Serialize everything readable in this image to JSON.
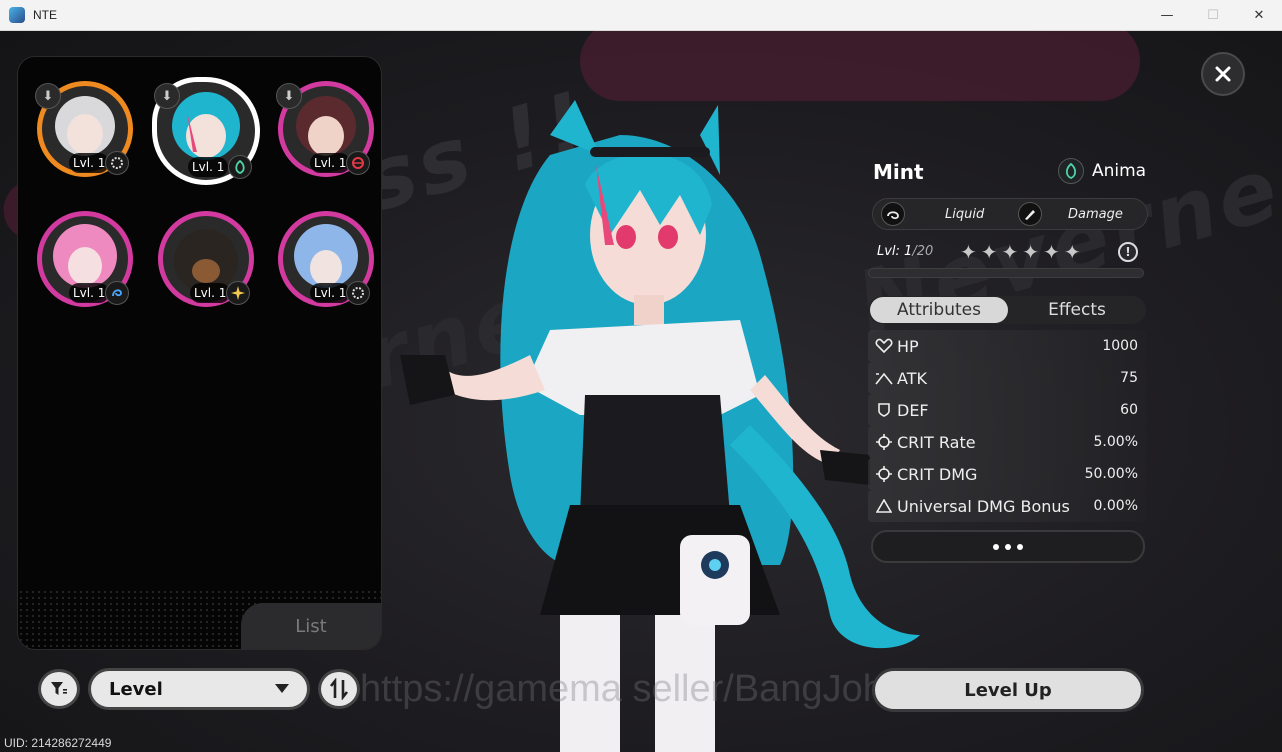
{
  "window": {
    "title": "NTE",
    "minimize": "—",
    "maximize": "☐",
    "close": "✕"
  },
  "roster": {
    "characters": [
      {
        "level": "Lvl. 1",
        "element_icon": "gear-icon",
        "ring": "orange"
      },
      {
        "level": "Lvl. 1",
        "element_icon": "anima-icon",
        "ring": "selected"
      },
      {
        "level": "Lvl. 1",
        "element_icon": "cosmos-icon",
        "ring": "pink"
      },
      {
        "level": "Lvl. 1",
        "element_icon": "swirl-icon",
        "ring": "pink"
      },
      {
        "level": "Lvl. 1",
        "element_icon": "spark-icon",
        "ring": "pink"
      },
      {
        "level": "Lvl. 1",
        "element_icon": "gear-icon",
        "ring": "pink"
      }
    ],
    "list_tab": "List"
  },
  "controls": {
    "sort_label": "Level",
    "uid": "UID: 214286272449",
    "watermark": "https://gamema      seller/BangJohn"
  },
  "character": {
    "name": "Mint",
    "faction": "Anima",
    "type1": "Liquid",
    "type2": "Damage",
    "level": "Lvl: 1",
    "level_max": "/20",
    "stars_total": 6,
    "xp_progress": 0
  },
  "tabs": {
    "attributes": "Attributes",
    "effects": "Effects"
  },
  "attributes": [
    {
      "name": "HP",
      "value": "1000",
      "icon": "heart-icon"
    },
    {
      "name": "ATK",
      "value": "75",
      "icon": "atk-icon"
    },
    {
      "name": "DEF",
      "value": "60",
      "icon": "shield-icon"
    },
    {
      "name": "CRIT Rate",
      "value": "5.00%",
      "icon": "crosshair-icon"
    },
    {
      "name": "CRIT DMG",
      "value": "50.00%",
      "icon": "crosshair-icon"
    },
    {
      "name": "Universal DMG Bonus",
      "value": "0.00%",
      "icon": "triangle-icon"
    }
  ],
  "buttons": {
    "level_up": "Level Up"
  },
  "colors": {
    "accent_pink": "#d23aa0",
    "accent_orange": "#ee8a1f",
    "hair_cyan": "#1fb5cf"
  }
}
